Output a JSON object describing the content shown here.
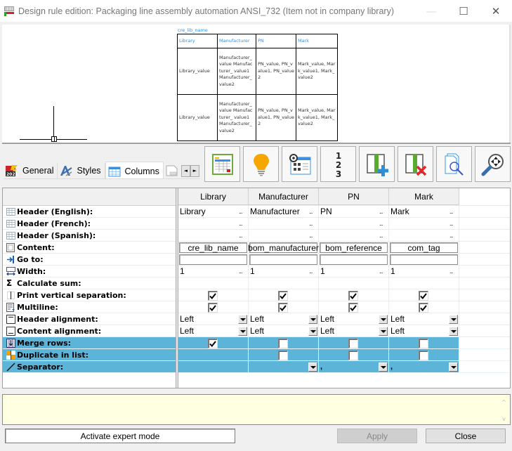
{
  "window": {
    "title": "Design rule edition: Packaging line assembly automation ANSI_732 (Item not in company library)",
    "minimize_icon": "—",
    "maximize_icon": "☐",
    "close_icon": "✕"
  },
  "preview": {
    "caption": "cre_lib_name",
    "header": [
      "Library",
      "Manufacturer",
      "PN",
      "Mark"
    ],
    "rows": [
      [
        "Library_value",
        "Manufacturer_ value Manufacturer_ value1 Manufacturer_ value2",
        "PN_value, PN_value1, PN_value2",
        "Mark_value, Mark_value1, Mark_value2"
      ],
      [
        "Library_value",
        "Manufacturer_ value Manufacturer_ value1 Manufacturer_ value2",
        "PN_value, PN_value1, PN_value2",
        "Mark_value, Mark_value1, Mark_value2"
      ]
    ]
  },
  "tabs": [
    {
      "label": "General",
      "icon": "general-2021-icon",
      "active": false
    },
    {
      "label": "Styles",
      "icon": "styles-icon",
      "active": false
    },
    {
      "label": "Columns",
      "icon": "columns-table-icon",
      "active": true
    }
  ],
  "tab_scroll": {
    "left": "◄",
    "right": "►"
  },
  "toolbar": [
    {
      "name": "table-layout-button",
      "icon": "table-layout-icon"
    },
    {
      "name": "tips-button",
      "icon": "lightbulb-icon"
    },
    {
      "name": "settings-button",
      "icon": "window-gear-icon"
    },
    {
      "name": "numbering-button",
      "icon": "numbering-123-icon"
    },
    {
      "name": "add-column-button",
      "icon": "add-column-icon"
    },
    {
      "name": "delete-column-button",
      "icon": "delete-column-icon"
    },
    {
      "name": "preview-document-button",
      "icon": "document-search-icon"
    },
    {
      "name": "zoom-fit-button",
      "icon": "zoom-navigate-icon"
    }
  ],
  "grid": {
    "columns": [
      "Library",
      "Manufacturer",
      "PN",
      "Mark"
    ],
    "properties": [
      {
        "label": "Header (English):",
        "icon": "header-icon"
      },
      {
        "label": "Header (French):",
        "icon": "header-icon"
      },
      {
        "label": "Header (Spanish):",
        "icon": "header-icon"
      },
      {
        "label": "Content:",
        "icon": "content-icon"
      },
      {
        "label": "Go to:",
        "icon": "goto-icon"
      },
      {
        "label": "Width:",
        "icon": "width-icon"
      },
      {
        "label": "Calculate sum:",
        "icon": "sigma-icon"
      },
      {
        "label": "Print vertical separation:",
        "icon": "vertical-separation-icon"
      },
      {
        "label": "Multiline:",
        "icon": "multiline-icon"
      },
      {
        "label": "Header alignment:",
        "icon": "header-alignment-icon"
      },
      {
        "label": "Content alignment:",
        "icon": "content-alignment-icon"
      },
      {
        "label": "Merge rows:",
        "icon": "merge-rows-icon",
        "selected": true
      },
      {
        "label": "Duplicate in list:",
        "icon": "duplicate-icon",
        "selected": true
      },
      {
        "label": "Separator:",
        "icon": "separator-icon",
        "selected": true
      }
    ],
    "header_en": [
      "Library",
      "Manufacturer",
      "PN",
      "Mark"
    ],
    "header_fr": [
      "",
      "",
      "",
      ""
    ],
    "header_es": [
      "",
      "",
      "",
      ""
    ],
    "content": [
      "cre_lib_name",
      "bom_manufacturer",
      "bom_reference",
      "com_tag"
    ],
    "goto": [
      "",
      "",
      "",
      ""
    ],
    "width": [
      "1",
      "1",
      "1",
      "1"
    ],
    "ellipsis": "...",
    "print_vertical_separation": [
      true,
      true,
      true,
      true
    ],
    "multiline": [
      true,
      true,
      true,
      true
    ],
    "header_alignment": [
      "Left",
      "Left",
      "Left",
      "Left"
    ],
    "content_alignment": [
      "Left",
      "Left",
      "Left",
      "Left"
    ],
    "merge_rows": [
      true,
      false,
      false,
      false
    ],
    "duplicate_in_list": [
      null,
      false,
      false,
      false
    ],
    "separator": [
      null,
      "",
      ",",
      ","
    ]
  },
  "message": {
    "text": "",
    "scroll_up": "^",
    "scroll_down": "v"
  },
  "buttons": {
    "expert": "Activate expert mode",
    "apply": "Apply",
    "close": "Close"
  }
}
